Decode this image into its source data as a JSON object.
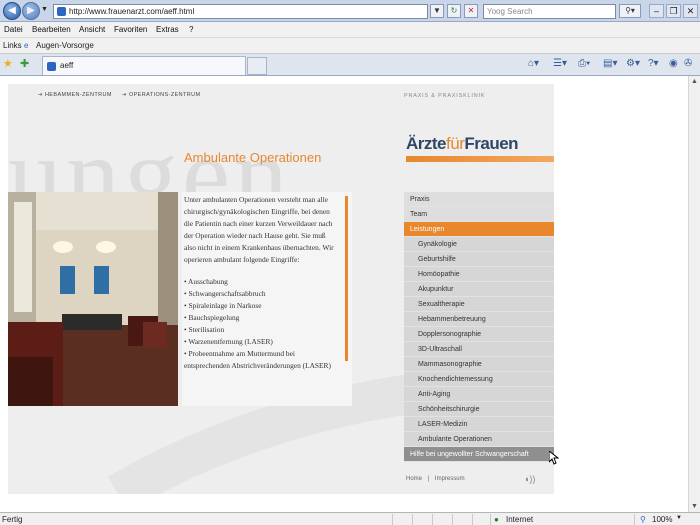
{
  "browser": {
    "url": "http://www.frauenarzt.com/aeff.html",
    "search_placeholder": "Yoog Search",
    "menu": [
      "Datei",
      "Bearbeiten",
      "Ansicht",
      "Favoriten",
      "Extras",
      "?"
    ],
    "links_label": "Links",
    "links_item": "Augen-Vorsorge",
    "tab_title": "aeff",
    "status_text": "Fertig",
    "zone": "Internet",
    "zoom": "100%"
  },
  "site": {
    "bg_word": "ungen",
    "topnav": [
      "HEBAMMEN-ZENTRUM",
      "OPERATIONS-ZENTRUM"
    ],
    "praxis_label": "PRAXIS & PRAXISKLINIK",
    "logo": {
      "part1": "Ärzte",
      "part2": "für",
      "part3": "Frauen"
    },
    "heading": "Ambulante Operationen",
    "paragraph": "Unter ambulanten Operationen versteht man alle chirurgisch/gynäkologischen Eingriffe, bei denen die Patientin nach einer kurzen Verweildauer nach der Operation wieder nach Hause geht. Sie muß also nicht in einem Krankenhaus übernachten. Wir operieren ambulant folgende Eingriffe:",
    "bullets": [
      "Ausschabung",
      "Schwangerschaftsabbruch",
      "Spiraleinlage in Narkose",
      "Bauchspiegelung",
      "Sterilisation",
      "Warzenentfernung (LASER)",
      "Probeentnahme am Muttermund bei entsprechenden Abstrichveränderungen (LASER)"
    ],
    "menu": [
      {
        "label": "Praxis",
        "type": "top"
      },
      {
        "label": "Team",
        "type": "top"
      },
      {
        "label": "Leistungen",
        "type": "active"
      },
      {
        "label": "Gynäkologie",
        "type": "sub"
      },
      {
        "label": "Geburtshilfe",
        "type": "sub"
      },
      {
        "label": "Homöopathie",
        "type": "sub"
      },
      {
        "label": "Akupunktur",
        "type": "sub"
      },
      {
        "label": "Sexualtherapie",
        "type": "sub"
      },
      {
        "label": "Hebammenbetreuung",
        "type": "sub"
      },
      {
        "label": "Dopplersonographie",
        "type": "sub"
      },
      {
        "label": "3D-Ultraschall",
        "type": "sub"
      },
      {
        "label": "Mammasonographie",
        "type": "sub"
      },
      {
        "label": "Knochendichtemessung",
        "type": "sub"
      },
      {
        "label": "Anti-Aging",
        "type": "sub"
      },
      {
        "label": "Schönheitschirurgie",
        "type": "sub"
      },
      {
        "label": "LASER-Medizin",
        "type": "sub"
      },
      {
        "label": "Ambulante Operationen",
        "type": "sub"
      },
      {
        "label": "Hilfe bei ungewollter Schwangerschaft",
        "type": "hover"
      }
    ],
    "footer": {
      "home": "Home",
      "separator": "|",
      "impressum": "Impressum"
    }
  }
}
